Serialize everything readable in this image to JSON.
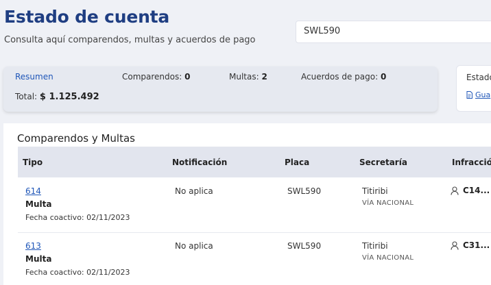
{
  "header": {
    "title": "Estado de cuenta",
    "subtitle": "Consulta aquí comparendos, multas y acuerdos de pago"
  },
  "search": {
    "value": "SWL590"
  },
  "summary": {
    "label": "Resumen",
    "comparendos_label": "Comparendos:",
    "comparendos_value": "0",
    "multas_label": "Multas:",
    "multas_value": "2",
    "acuerdos_label": "Acuerdos de pago:",
    "acuerdos_value": "0",
    "total_label": "Total:",
    "total_value": "$ 1.125.492"
  },
  "state_card": {
    "title": "Estado",
    "link": "Gua"
  },
  "table": {
    "title": "Comparendos y Multas",
    "headers": {
      "tipo": "Tipo",
      "notificacion": "Notificación",
      "placa": "Placa",
      "secretaria": "Secretaría",
      "infraccion": "Infracción"
    },
    "rows": [
      {
        "numero": "614",
        "tipo": "Multa",
        "fecha": "Fecha coactivo: 02/11/2023",
        "notificacion": "No aplica",
        "placa": "SWL590",
        "secretaria": "Titiribi",
        "secretaria_sub": "VÍA NACIONAL",
        "infraccion": "C14..."
      },
      {
        "numero": "613",
        "tipo": "Multa",
        "fecha": "Fecha coactivo: 02/11/2023",
        "notificacion": "No aplica",
        "placa": "SWL590",
        "secretaria": "Titiribi",
        "secretaria_sub": "VÍA NACIONAL",
        "infraccion": "C31..."
      }
    ]
  },
  "colors": {
    "title": "#1f3e82",
    "link": "#1f56b8",
    "background": "#eff1f6",
    "table_header": "#e2e5ee"
  },
  "icons": {
    "person": "person-icon",
    "document": "document-icon"
  }
}
